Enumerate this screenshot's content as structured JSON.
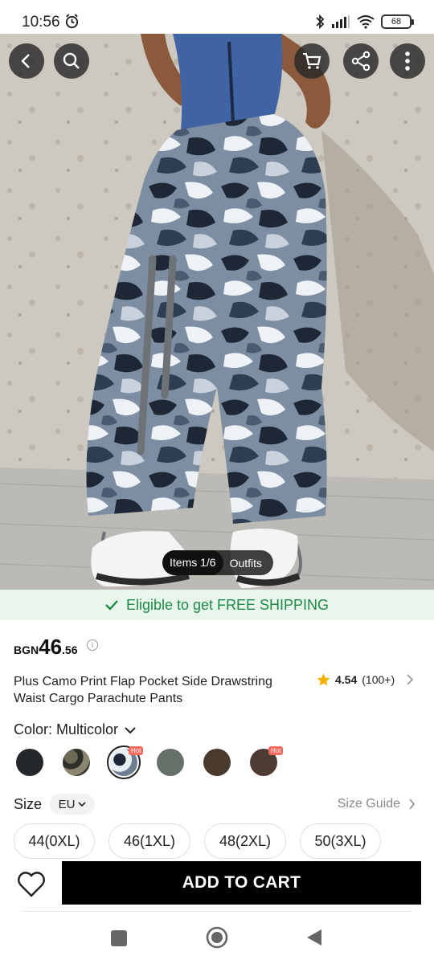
{
  "status_bar": {
    "time": "10:56",
    "battery": "68"
  },
  "gallery": {
    "items_label": "Items 1/6",
    "outfits_label": "Outfits"
  },
  "shipping_banner": {
    "text": "Eligible to get FREE SHIPPING"
  },
  "product": {
    "currency": "BGN",
    "price_int": "46",
    "price_dec": ".56",
    "title": "Plus Camo Print Flap Pocket Side Drawstring Waist Cargo Parachute Pants",
    "rating": "4.54",
    "review_count": "(100+)"
  },
  "color": {
    "label": "Color: Multicolor",
    "hot_label": "Hot",
    "swatches": [
      {
        "name": "black",
        "color": "#24282a"
      },
      {
        "name": "green-camo",
        "color": "#5c5a4a"
      },
      {
        "name": "grey-camo",
        "color": "#6f7f92"
      },
      {
        "name": "grey",
        "color": "#667068"
      },
      {
        "name": "brown",
        "color": "#4a3a2e"
      },
      {
        "name": "dark-brown",
        "color": "#4d3a30"
      }
    ]
  },
  "size": {
    "label": "Size",
    "system": "EU",
    "guide": "Size Guide",
    "options": [
      "44(0XL)",
      "46(1XL)",
      "48(2XL)",
      "50(3XL)"
    ]
  },
  "actions": {
    "add_to_cart": "ADD TO CART"
  },
  "colors": {
    "accent_green": "#1f8a47",
    "banner_bg": "#e8f6ec",
    "star": "#f5b301",
    "hot_badge": "#f7685d"
  }
}
